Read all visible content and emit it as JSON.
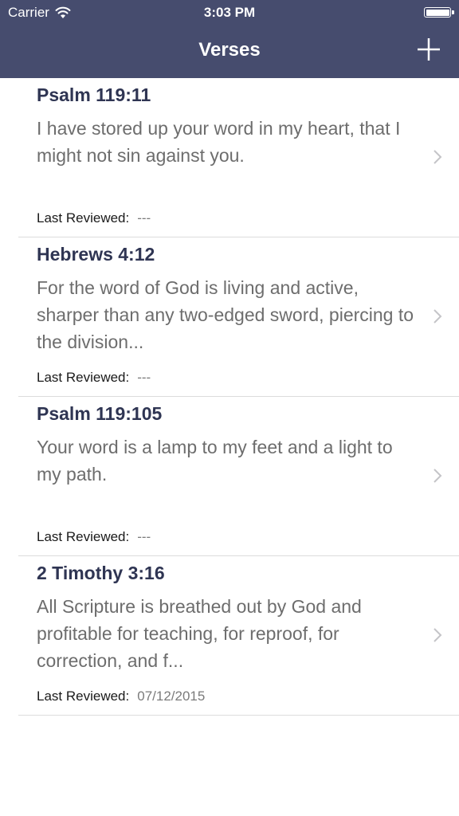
{
  "status_bar": {
    "carrier": "Carrier",
    "time": "3:03 PM"
  },
  "nav": {
    "title": "Verses",
    "add_icon": "plus-icon"
  },
  "footer_label": "Last Reviewed:",
  "verses": [
    {
      "reference": "Psalm 119:11",
      "text": "I have stored up your word in my heart, that I might not sin against you.",
      "last_reviewed": "---"
    },
    {
      "reference": "Hebrews 4:12",
      "text": "For the word of God is living and active, sharper than any two-edged sword, piercing to the division...",
      "last_reviewed": "---"
    },
    {
      "reference": "Psalm 119:105",
      "text": "Your word is a lamp to my feet and a light to my path.",
      "last_reviewed": "---"
    },
    {
      "reference": "2 Timothy 3:16",
      "text": "All Scripture is breathed out by God and profitable for teaching, for reproof, for correction, and f...",
      "last_reviewed": "07/12/2015"
    }
  ],
  "colors": {
    "nav_background": "#464c6e",
    "title_text": "#2f3553",
    "body_text": "#6d6d6d"
  }
}
